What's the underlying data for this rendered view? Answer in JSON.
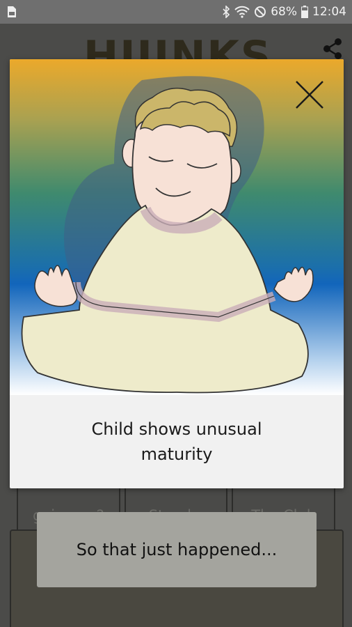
{
  "status_bar": {
    "battery": "68%",
    "time": "12:04",
    "icons": [
      "sim-icon",
      "bluetooth-icon",
      "wifi-icon",
      "do-not-disturb-icon",
      "battery-icon"
    ]
  },
  "app": {
    "title": "HIJINKS",
    "share_icon": "share-icon",
    "tiles": [
      "going on?",
      "Streaks",
      "The Club"
    ]
  },
  "card": {
    "caption": "Child shows unusual maturity",
    "close_icon": "close-icon"
  },
  "toast": {
    "message": "So that just happened..."
  },
  "colors": {
    "gradient_top": "#eba92b",
    "gradient_mid": "#1265bb",
    "robe": "#eeebcb",
    "skin": "#f7e1d6",
    "hair": "#cbb66a"
  }
}
